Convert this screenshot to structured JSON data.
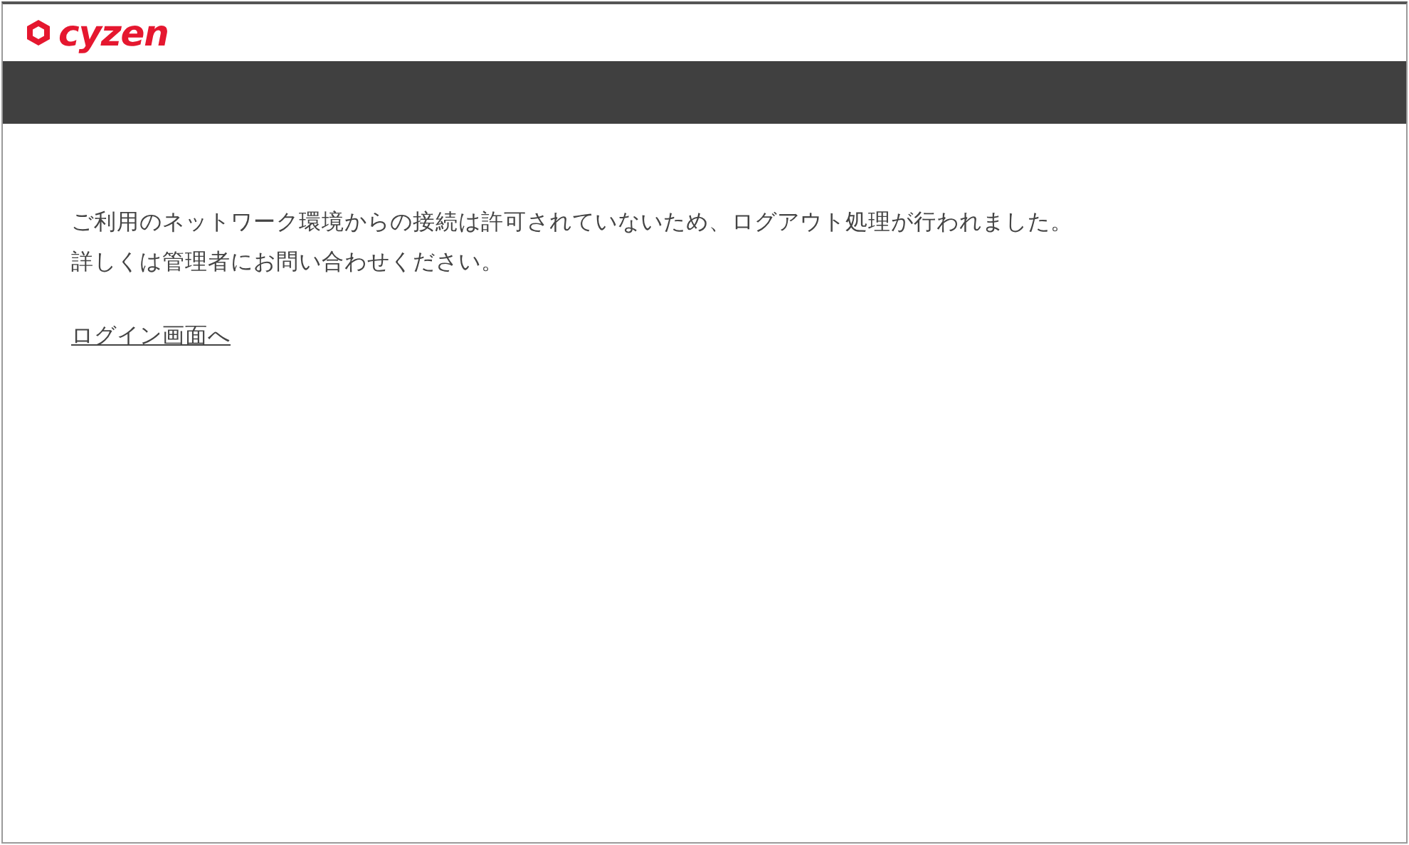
{
  "header": {
    "logo": "cyzen"
  },
  "message": {
    "lines": [
      "ご利用のネットワーク環境からの接続は許可されていないため、ログアウト処理が行われました。",
      "詳しくは管理者にお問い合わせください。"
    ]
  },
  "link": "ログイン画面へ"
}
